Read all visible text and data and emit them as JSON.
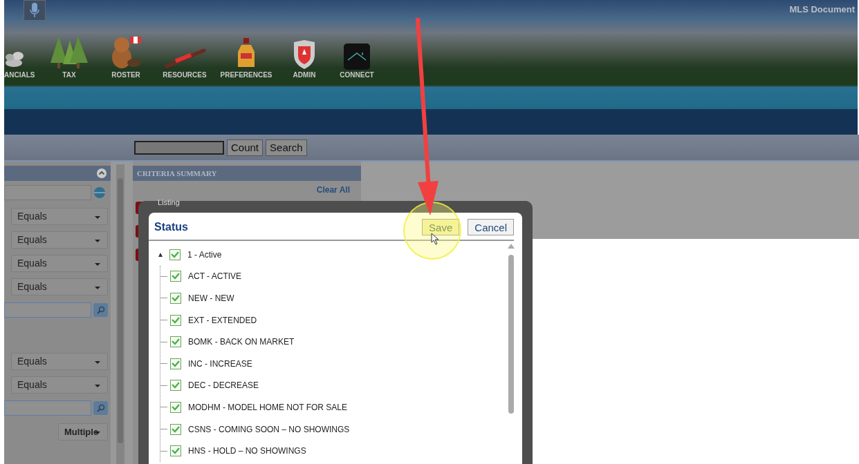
{
  "banner": {
    "corner_text": "MLS Document",
    "nav": [
      {
        "label": "ANCIALS",
        "kind": "rocks"
      },
      {
        "label": "TAX",
        "kind": "trees"
      },
      {
        "label": "ROSTER",
        "kind": "beaver"
      },
      {
        "label": "RESOURCES",
        "kind": "toboggan"
      },
      {
        "label": "PREFERENCES",
        "kind": "syrup"
      },
      {
        "label": "ADMIN",
        "kind": "shield"
      },
      {
        "label": "CONNECT",
        "kind": "house"
      }
    ]
  },
  "toolbar": {
    "buttons": [
      "Count",
      "Search"
    ]
  },
  "left_panel": {
    "rows": [
      {
        "kind": "field"
      },
      {
        "kind": "select",
        "value": "Equals"
      },
      {
        "kind": "select",
        "value": "Equals"
      },
      {
        "kind": "select",
        "value": "Equals"
      },
      {
        "kind": "select",
        "value": "Equals"
      },
      {
        "kind": "lookup"
      },
      {
        "kind": "gap"
      },
      {
        "kind": "select",
        "value": "Equals"
      },
      {
        "kind": "select",
        "value": "Equals"
      },
      {
        "kind": "lookup"
      },
      {
        "kind": "small_select",
        "value": "Multiple"
      }
    ]
  },
  "criteria_summary": {
    "title": "CRITERIA SUMMARY",
    "clear_all": "Clear All",
    "items": [
      {
        "kind": "labelled",
        "label": "Listing"
      },
      {
        "kind": "plain"
      },
      {
        "kind": "plain"
      }
    ]
  },
  "modal": {
    "title": "Status",
    "buttons": [
      {
        "label": "Save",
        "highlighted": true
      },
      {
        "label": "Cancel",
        "highlighted": false
      }
    ],
    "tree": [
      {
        "label": "1 - Active",
        "checked": true,
        "expanded": true,
        "children": [
          {
            "label": "ACT - ACTIVE",
            "checked": true
          },
          {
            "label": "NEW - NEW",
            "checked": true
          },
          {
            "label": "EXT - EXTENDED",
            "checked": true
          },
          {
            "label": "BOMK - BACK ON MARKET",
            "checked": true
          },
          {
            "label": "INC - INCREASE",
            "checked": true
          },
          {
            "label": "DEC - DECREASE",
            "checked": true
          },
          {
            "label": "MODHM - MODEL HOME NOT FOR SALE",
            "checked": true
          },
          {
            "label": "CSNS - COMING SOON – NO SHOWINGS",
            "checked": true
          },
          {
            "label": "HNS - HOLD – NO SHOWINGS",
            "checked": true
          }
        ]
      }
    ]
  }
}
